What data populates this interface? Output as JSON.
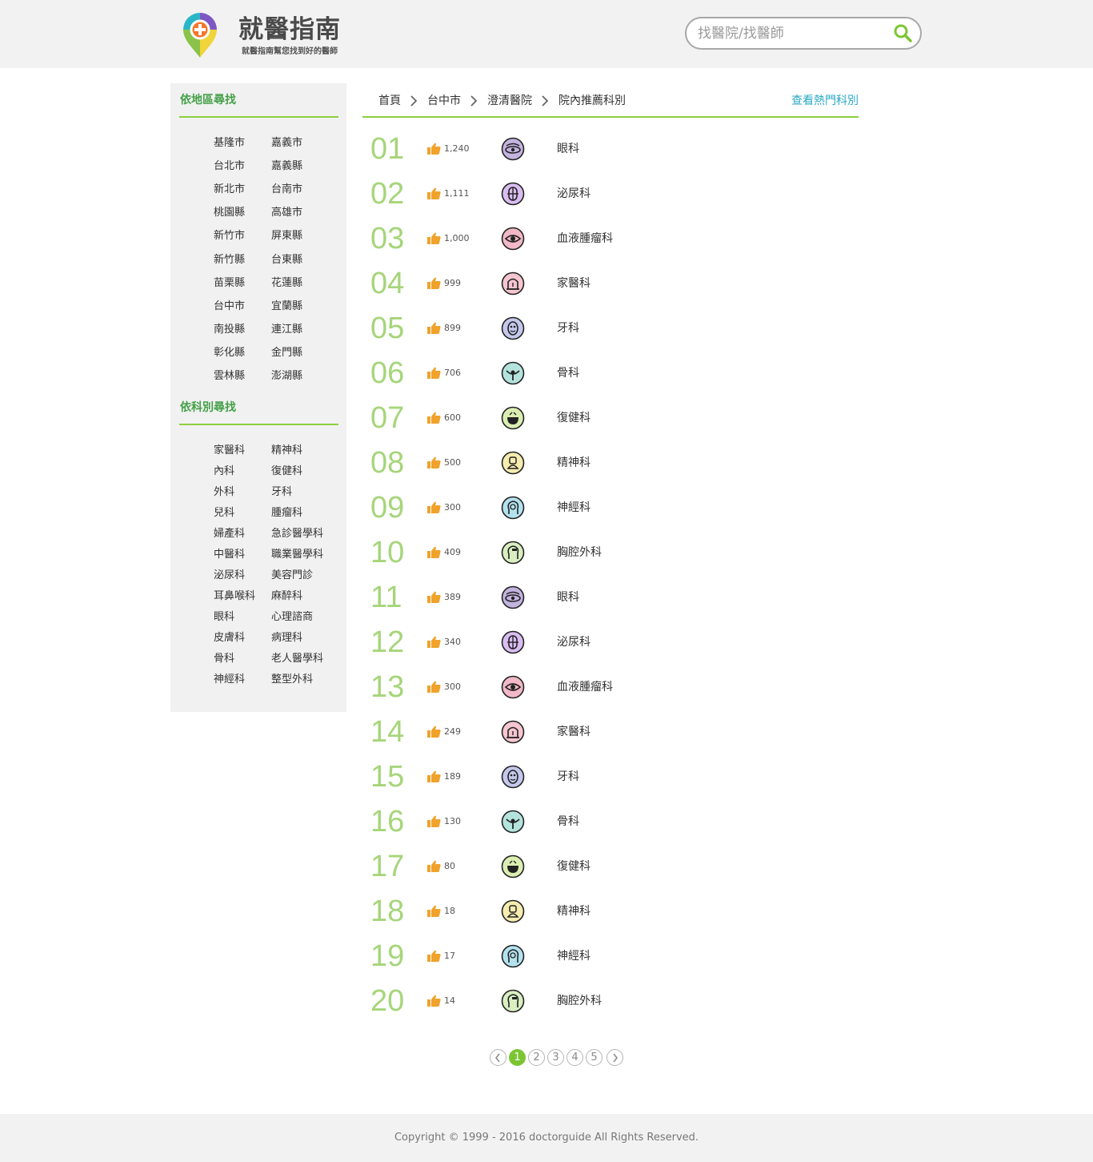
{
  "header": {
    "brand": "就醫指南",
    "slogan": "就醫指南幫您找到好的醫師",
    "search_placeholder": "找醫院/找醫師",
    "search_icon": "search-icon"
  },
  "sidebar": {
    "region_title": "依地區尋找",
    "regions": [
      "基隆市",
      "嘉義市",
      "台北市",
      "嘉義縣",
      "新北市",
      "台南市",
      "桃園縣",
      "高雄市",
      "新竹市",
      "屏東縣",
      "新竹縣",
      "台東縣",
      "苗栗縣",
      "花蓮縣",
      "台中市",
      "宜蘭縣",
      "南投縣",
      "連江縣",
      "彰化縣",
      "金門縣",
      "雲林縣",
      "澎湖縣"
    ],
    "dept_title": "依科別尋找",
    "departments": [
      "家醫科",
      "精神科",
      "內科",
      "復健科",
      "外科",
      "牙科",
      "兒科",
      "腫瘤科",
      "婦產科",
      "急診醫學科",
      "中醫科",
      "職業醫學科",
      "泌尿科",
      "美容門診",
      "耳鼻喉科",
      "麻醉科",
      "眼科",
      "心理諮商",
      "皮膚科",
      "病理科",
      "骨科",
      "老人醫學科",
      "神經科",
      "整型外科"
    ]
  },
  "breadcrumb": {
    "items": [
      "首頁",
      "台中市",
      "澄清醫院",
      "院內推薦科別"
    ],
    "hot_link": "查看熱門科別"
  },
  "ranking": [
    {
      "rank": "01",
      "likes": "1,240",
      "dept": "眼科",
      "icon": "eye-dept-icon",
      "color": "#c3b3df"
    },
    {
      "rank": "02",
      "likes": "1,111",
      "dept": "泌尿科",
      "icon": "urology-dept-icon",
      "color": "#d9bdf0"
    },
    {
      "rank": "03",
      "likes": "1,000",
      "dept": "血液腫瘤科",
      "icon": "hematology-dept-icon",
      "color": "#f2b8c6"
    },
    {
      "rank": "04",
      "likes": "999",
      "dept": "家醫科",
      "icon": "family-medicine-dept-icon",
      "color": "#f5c6cf"
    },
    {
      "rank": "05",
      "likes": "899",
      "dept": "牙科",
      "icon": "dental-dept-icon",
      "color": "#c5c8ec"
    },
    {
      "rank": "06",
      "likes": "706",
      "dept": "骨科",
      "icon": "orthopedics-dept-icon",
      "color": "#b4e3de"
    },
    {
      "rank": "07",
      "likes": "600",
      "dept": "復健科",
      "icon": "rehabilitation-dept-icon",
      "color": "#dbeeb2"
    },
    {
      "rank": "08",
      "likes": "500",
      "dept": "精神科",
      "icon": "psychiatry-dept-icon",
      "color": "#f6ecb0"
    },
    {
      "rank": "09",
      "likes": "300",
      "dept": "神經科",
      "icon": "neurology-dept-icon",
      "color": "#b3e2ee"
    },
    {
      "rank": "10",
      "likes": "409",
      "dept": "胸腔外科",
      "icon": "thoracic-surgery-dept-icon",
      "color": "#d9efc1"
    },
    {
      "rank": "11",
      "likes": "389",
      "dept": "眼科",
      "icon": "eye-dept-icon",
      "color": "#c3b3df"
    },
    {
      "rank": "12",
      "likes": "340",
      "dept": "泌尿科",
      "icon": "urology-dept-icon",
      "color": "#d9bdf0"
    },
    {
      "rank": "13",
      "likes": "300",
      "dept": "血液腫瘤科",
      "icon": "hematology-dept-icon",
      "color": "#f2b8c6"
    },
    {
      "rank": "14",
      "likes": "249",
      "dept": "家醫科",
      "icon": "family-medicine-dept-icon",
      "color": "#f5c6cf"
    },
    {
      "rank": "15",
      "likes": "189",
      "dept": "牙科",
      "icon": "dental-dept-icon",
      "color": "#c5c8ec"
    },
    {
      "rank": "16",
      "likes": "130",
      "dept": "骨科",
      "icon": "orthopedics-dept-icon",
      "color": "#b4e3de"
    },
    {
      "rank": "17",
      "likes": "80",
      "dept": "復健科",
      "icon": "rehabilitation-dept-icon",
      "color": "#dbeeb2"
    },
    {
      "rank": "18",
      "likes": "18",
      "dept": "精神科",
      "icon": "psychiatry-dept-icon",
      "color": "#f6ecb0"
    },
    {
      "rank": "19",
      "likes": "17",
      "dept": "神經科",
      "icon": "neurology-dept-icon",
      "color": "#b3e2ee"
    },
    {
      "rank": "20",
      "likes": "14",
      "dept": "胸腔外科",
      "icon": "thoracic-surgery-dept-icon",
      "color": "#d9efc1"
    }
  ],
  "pagination": {
    "pages": [
      "1",
      "2",
      "3",
      "4",
      "5"
    ],
    "current": "1"
  },
  "footer": {
    "copyright": "Copyright © 1999 - 2016 doctorguide All Rights Reserved."
  },
  "colors": {
    "accent_green": "#8ccf3f",
    "rank_number": "#a6d57a",
    "link_teal": "#29a9c4",
    "thumb_orange": "#f0a22b",
    "sidebar_title": "#43a047"
  }
}
